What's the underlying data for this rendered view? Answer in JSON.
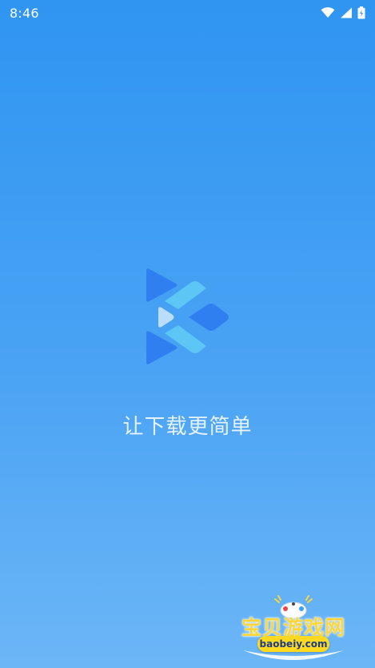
{
  "status_bar": {
    "time": "8:46",
    "icons": [
      "wifi-icon",
      "signal-icon",
      "battery-icon"
    ]
  },
  "splash": {
    "logo": "app-logo-icon",
    "slogan": "让下载更简单"
  },
  "watermark": {
    "title": "宝贝游戏网",
    "url": "baobeiy.com"
  },
  "colors": {
    "background_top": "#2f95f1",
    "background_bottom": "#6cb6f6",
    "logo_dark": "#2f7ff0",
    "logo_light": "#5ec6f5",
    "watermark_yellow": "#ffd63a"
  }
}
